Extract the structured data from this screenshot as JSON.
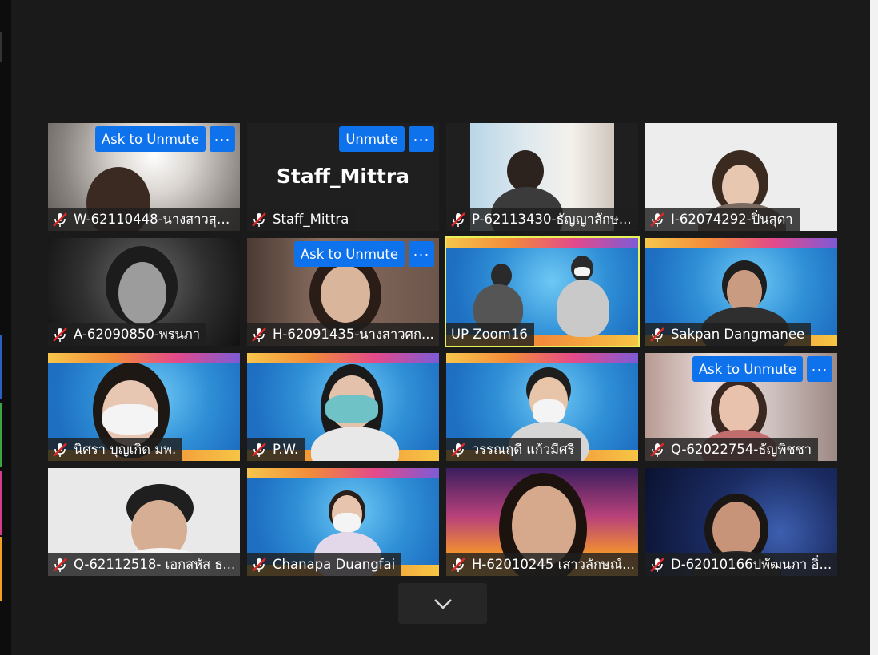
{
  "app": "Zoom",
  "colors": {
    "unmute_button": "#0e72ed",
    "active_speaker": "#e8f05a",
    "background": "#1a1a1a"
  },
  "icons": {
    "muted_mic": "muted-mic-icon",
    "more": "more-options-icon",
    "scroll_down": "chevron-down-icon"
  },
  "tiles": [
    {
      "name": "W-62110448-นางสาวสุชั...",
      "button": "Ask to Unmute",
      "more": "···"
    },
    {
      "name": "Staff_Mittra",
      "label": "Staff_Mittra",
      "button": "Unmute",
      "more": "···"
    },
    {
      "name": "P-62113430-ธัญญาลักษ..."
    },
    {
      "name": "I-62074292-ปิ่นสุดา"
    },
    {
      "name": "A-62090850-พรนภา"
    },
    {
      "name": "H-62091435-นางสาวศก...",
      "button": "Ask to Unmute",
      "more": "···"
    },
    {
      "name": "UP Zoom16"
    },
    {
      "name": "Sakpan Dangmanee"
    },
    {
      "name": "นิศรา บุญเกิด มพ."
    },
    {
      "name": "P.W."
    },
    {
      "name": "วรรณฤดี แก้วมีศรี"
    },
    {
      "name": "Q-62022754-ธัญพิชชา",
      "button": "Ask to Unmute",
      "more": "···"
    },
    {
      "name": "Q-62112518- เอกสหัส ธ..."
    },
    {
      "name": "Chanapa Duangfai"
    },
    {
      "name": "H-62010245 เสาวลักษณ์..."
    },
    {
      "name": "D-62010166ปพัฒนภา อิ่..."
    }
  ]
}
